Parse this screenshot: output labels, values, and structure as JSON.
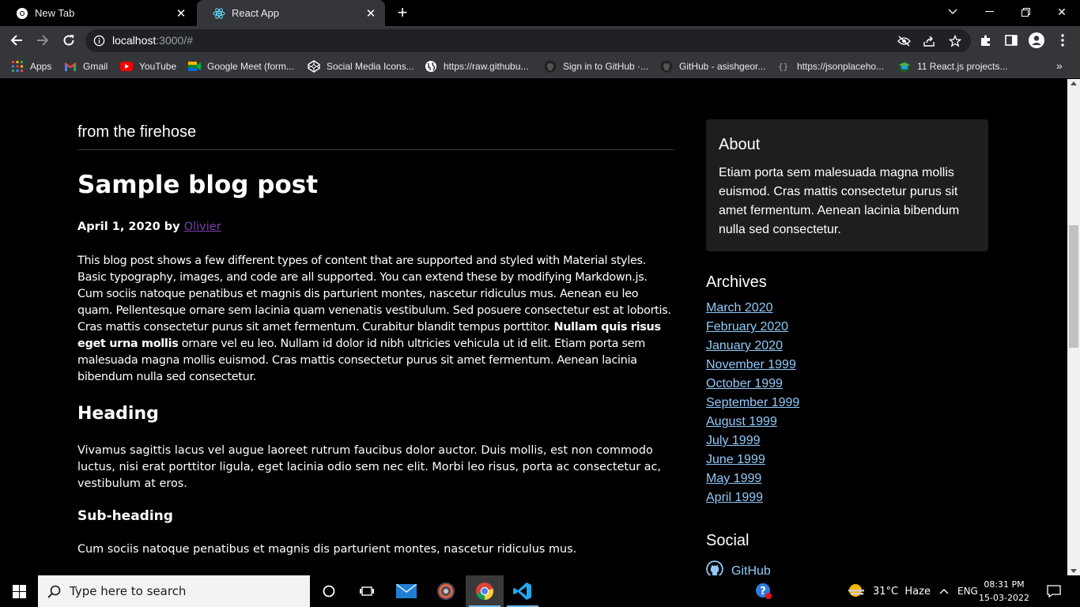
{
  "browser": {
    "tabs": [
      {
        "title": "New Tab",
        "icon": "chrome-icon"
      },
      {
        "title": "React App",
        "icon": "react-icon"
      }
    ],
    "address": {
      "host": "localhost",
      "rest": ":3000/#"
    },
    "bookmarks": [
      {
        "label": "Apps",
        "icon": "apps-grid-icon"
      },
      {
        "label": "Gmail",
        "icon": "gmail-icon"
      },
      {
        "label": "YouTube",
        "icon": "youtube-icon"
      },
      {
        "label": "Google Meet (form...",
        "icon": "google-meet-icon"
      },
      {
        "label": "Social Media Icons...",
        "icon": "codepen-icon"
      },
      {
        "label": "https://raw.githubu...",
        "icon": "globe-icon"
      },
      {
        "label": "Sign in to GitHub ·...",
        "icon": "github-icon"
      },
      {
        "label": "GitHub - asishgeor...",
        "icon": "github-icon"
      },
      {
        "label": "https://jsonplaceho...",
        "icon": "json-icon"
      },
      {
        "label": "11 React.js projects...",
        "icon": "graduation-cap-icon"
      }
    ]
  },
  "page": {
    "section_title": "from the firehose",
    "post": {
      "title": "Sample blog post",
      "date_prefix": "April 1, 2020 by",
      "author": "Olivier",
      "p1_a": "This blog post shows a few different types of content that are supported and styled with Material styles. Basic typography, images, and code are all supported. You can extend these by modifying Markdown.js. Cum sociis natoque penatibus et magnis dis parturient montes, nascetur ridiculus mus. Aenean eu leo quam. Pellentesque ornare sem lacinia quam venenatis vestibulum. Sed posuere consectetur est at lobortis. Cras mattis consectetur purus sit amet fermentum. Curabitur blandit tempus porttitor.",
      "p1_bold": "Nullam quis risus eget urna mollis",
      "p1_b": "ornare vel eu leo. Nullam id dolor id nibh ultricies vehicula ut id elit. Etiam porta sem malesuada magna mollis euismod. Cras mattis consectetur purus sit amet fermentum. Aenean lacinia bibendum nulla sed consectetur.",
      "heading": "Heading",
      "p2": "Vivamus sagittis lacus vel augue laoreet rutrum faucibus dolor auctor. Duis mollis, est non commodo luctus, nisi erat porttitor ligula, eget lacinia odio sem nec elit. Morbi leo risus, porta ac consectetur ac, vestibulum at eros.",
      "subheading": "Sub-heading",
      "p3": "Cum sociis natoque penatibus et magnis dis parturient montes, nascetur ridiculus mus."
    },
    "sidebar": {
      "about_title": "About",
      "about_text": "Etiam porta sem malesuada magna mollis euismod. Cras mattis consectetur purus sit amet fermentum. Aenean lacinia bibendum nulla sed consectetur.",
      "archives_title": "Archives",
      "archives": [
        "March 2020",
        "February 2020",
        "January 2020",
        "November 1999",
        "October 1999",
        "September 1999",
        "August 1999",
        "July 1999",
        "June 1999",
        "May 1999",
        "April 1999"
      ],
      "social_title": "Social",
      "social": [
        {
          "label": "GitHub",
          "icon": "github-icon"
        }
      ]
    }
  },
  "taskbar": {
    "search_placeholder": "Type here to search",
    "weather": "31°C  Haze",
    "language": "ENG",
    "time": "08:31 PM",
    "date": "15-03-2022"
  },
  "colors": {
    "link_archive": "#90caf9",
    "link_author": "#7b3fb0",
    "card_bg": "#1e1e1e",
    "toolbar_bg": "#35363a"
  }
}
